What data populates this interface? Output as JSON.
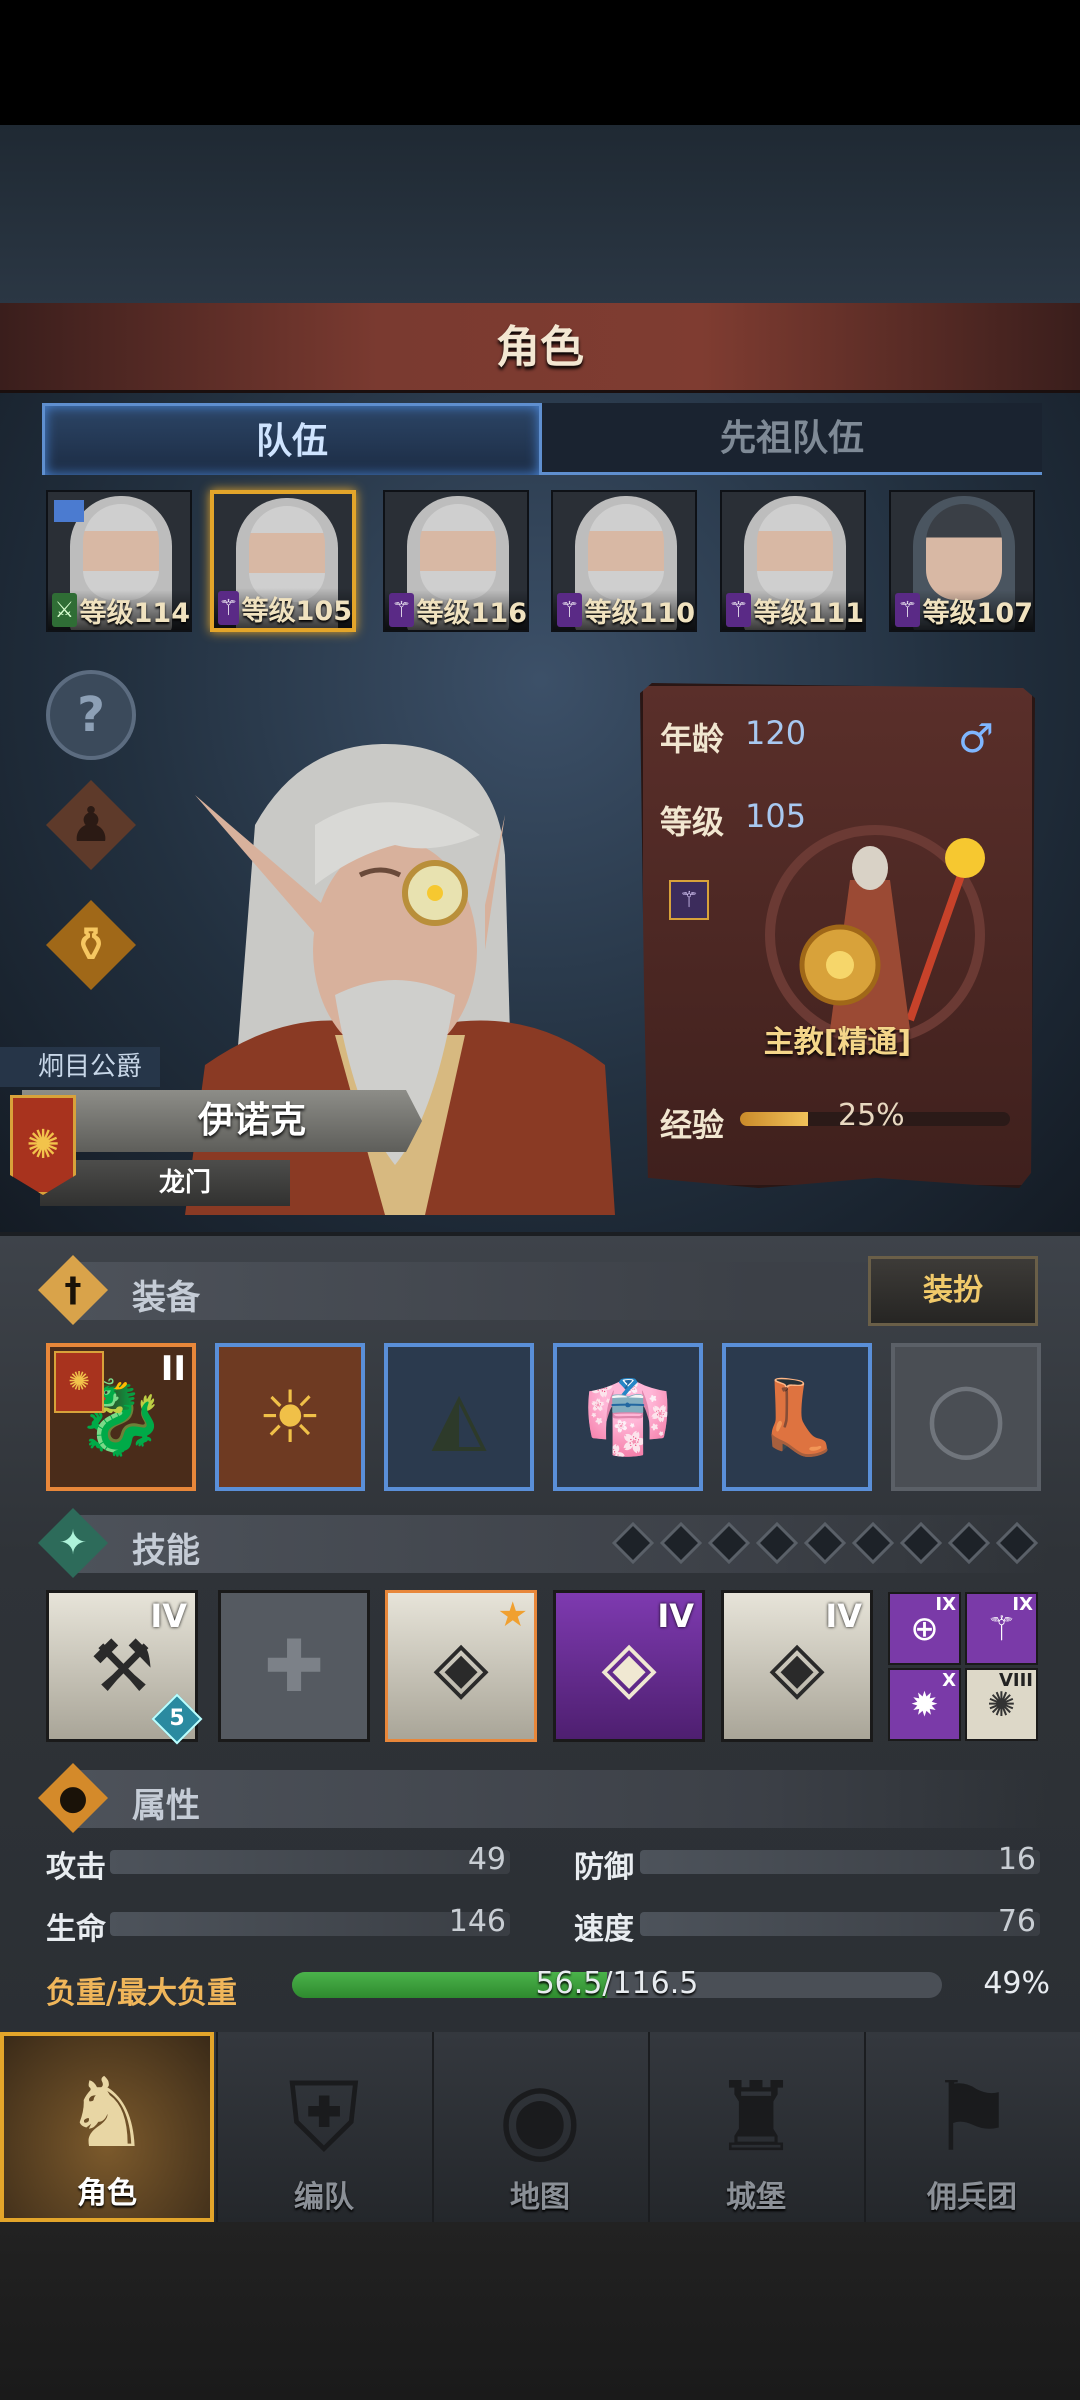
{
  "header": {
    "title": "角色"
  },
  "tabs": [
    {
      "label": "队伍",
      "active": true
    },
    {
      "label": "先祖队伍",
      "active": false
    }
  ],
  "team": [
    {
      "level_text": "等级114",
      "weapon_icon": "sword-icon",
      "selected": false
    },
    {
      "level_text": "等级105",
      "weapon_icon": "staff-icon",
      "selected": true
    },
    {
      "level_text": "等级116",
      "weapon_icon": "staff-icon",
      "selected": false
    },
    {
      "level_text": "等级110",
      "weapon_icon": "staff-icon",
      "selected": false
    },
    {
      "level_text": "等级111",
      "weapon_icon": "staff-icon",
      "selected": false
    },
    {
      "level_text": "等级107",
      "weapon_icon": "staff-icon",
      "selected": false
    }
  ],
  "side_buttons": [
    "help-icon",
    "equipment-figure-icon",
    "potion-icon"
  ],
  "character": {
    "title": "炯目公爵",
    "name": "伊诺克",
    "origin": "龙门",
    "age_label": "年龄",
    "age": "120",
    "gender_icon": "male-icon",
    "level_label": "等级",
    "level": "105",
    "class_name": "主教[精通]",
    "exp_label": "经验",
    "exp_pct_text": "25%",
    "exp_fraction": 0.25
  },
  "equipment": {
    "section_title": "装备",
    "dress_button": "装扮",
    "slots": [
      {
        "icon": "dragon-staff-icon",
        "tier": "II",
        "rarity": "legendary"
      },
      {
        "icon": "sun-shield-icon",
        "rarity": "rare"
      },
      {
        "icon": "hood-icon",
        "rarity": "rare"
      },
      {
        "icon": "robe-icon",
        "rarity": "rare"
      },
      {
        "icon": "boots-icon",
        "rarity": "rare"
      },
      {
        "icon": "ring-slot-icon",
        "rarity": "empty"
      }
    ]
  },
  "skills": {
    "section_title": "技能",
    "point_count": 9,
    "main": [
      {
        "icon": "staff-strike-icon",
        "tier": "IV",
        "badge": "5",
        "style": "white"
      },
      {
        "icon": "cross-empty-icon",
        "style": "empty"
      },
      {
        "icon": "holy-crystal-icon",
        "style": "white-orange"
      },
      {
        "icon": "crystal-shield-icon",
        "tier": "IV",
        "style": "purple"
      },
      {
        "icon": "crystal-shield-icon",
        "tier": "IV",
        "style": "white"
      }
    ],
    "minor": [
      {
        "icon": "target-icon",
        "tier": "IX"
      },
      {
        "icon": "wand-icon",
        "tier": "IX"
      },
      {
        "icon": "burst-icon",
        "tier": "X"
      },
      {
        "icon": "nova-icon",
        "tier": "VIII"
      }
    ]
  },
  "attributes": {
    "section_title": "属性",
    "rows": [
      {
        "label": "攻击",
        "value": "49"
      },
      {
        "label": "防御",
        "value": "16"
      },
      {
        "label": "生命",
        "value": "146"
      },
      {
        "label": "速度",
        "value": "76"
      }
    ],
    "load_label": "负重/最大负重",
    "load_text": "56.5/116.5",
    "load_pct_text": "49%",
    "load_fraction": 0.485
  },
  "nav": [
    {
      "label": "角色",
      "icon": "knight-icon",
      "active": true
    },
    {
      "label": "编队",
      "icon": "helmet-icon",
      "active": false
    },
    {
      "label": "地图",
      "icon": "compass-map-icon",
      "active": false
    },
    {
      "label": "城堡",
      "icon": "castle-icon",
      "active": false
    },
    {
      "label": "佣兵团",
      "icon": "mercenary-icon",
      "active": false
    }
  ],
  "colors": {
    "accent_gold": "#e3a52a",
    "tab_blue": "#5f8fcf",
    "title_red": "#7a3a30"
  }
}
